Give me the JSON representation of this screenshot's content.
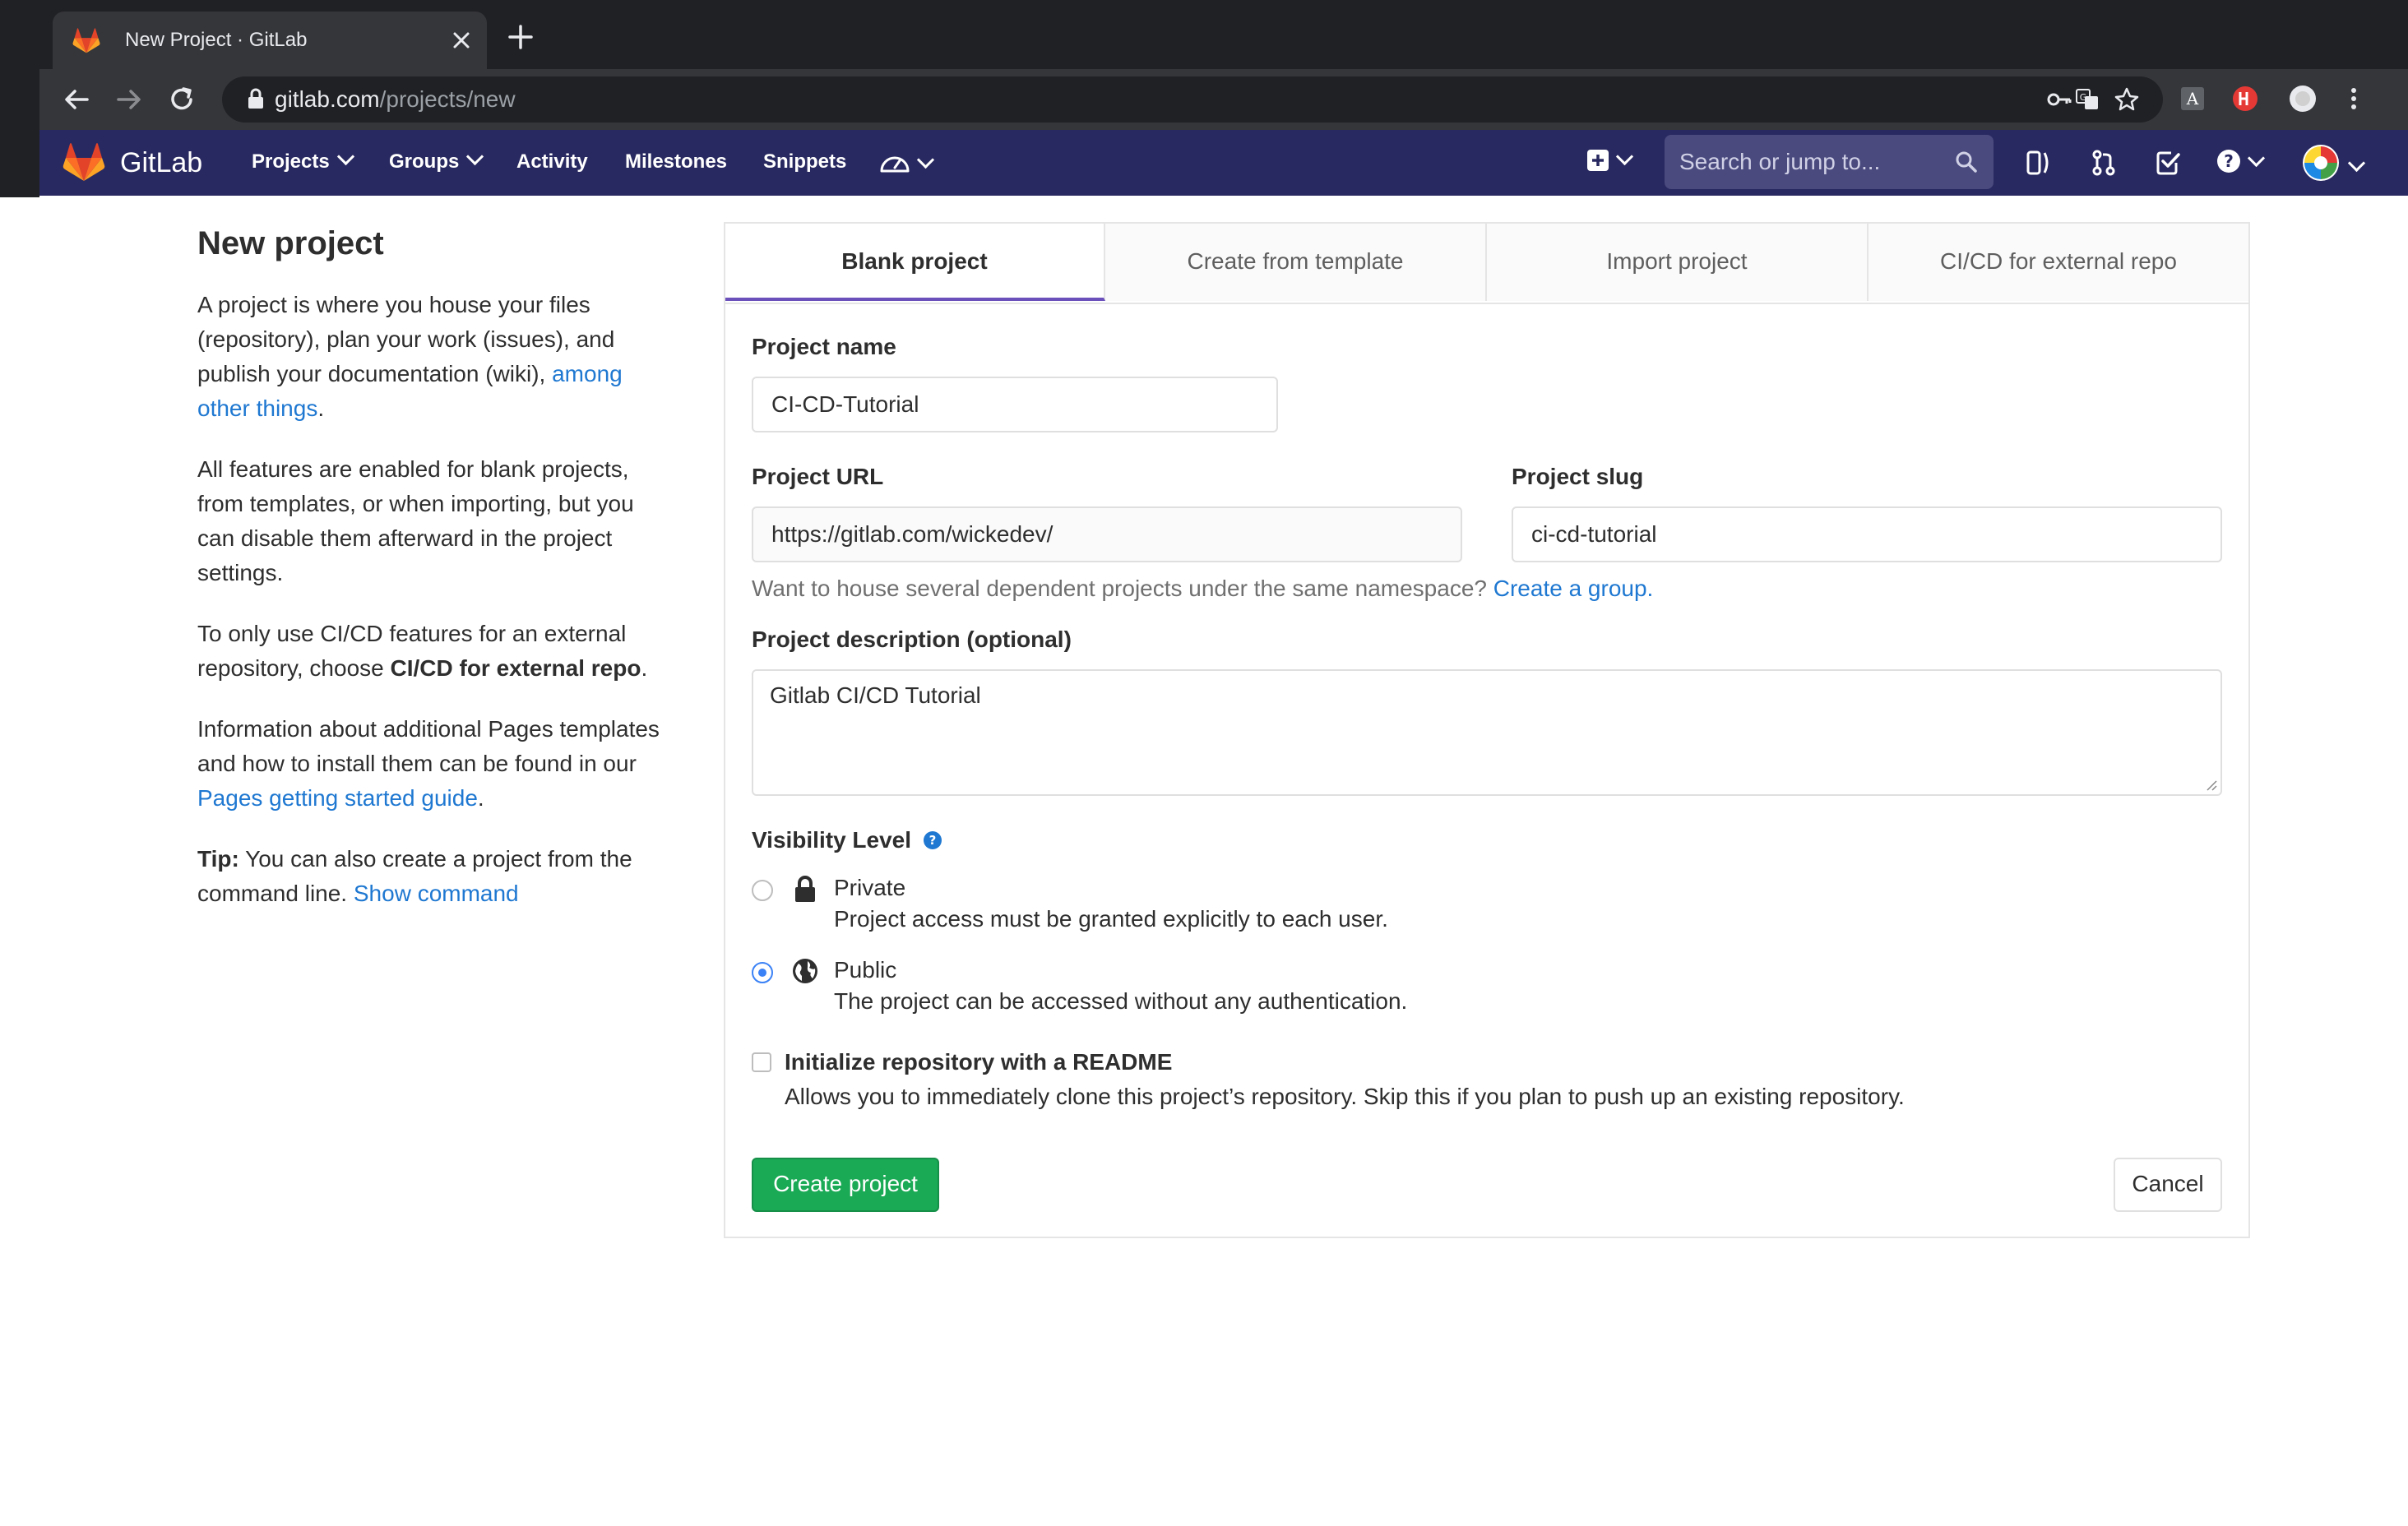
{
  "browser": {
    "tab_title": "New Project · GitLab",
    "url_host": "gitlab.com",
    "url_path": "/projects/new"
  },
  "navbar": {
    "brand": "GitLab",
    "links": [
      "Projects",
      "Groups",
      "Activity",
      "Milestones",
      "Snippets"
    ],
    "search_placeholder": "Search or jump to..."
  },
  "sidebar": {
    "title": "New project",
    "p1_text": "A project is where you house your files (repository), plan your work (issues), and publish your documentation (wiki), ",
    "p1_link": "among other things",
    "p1_end": ".",
    "p2": "All features are enabled for blank projects, from templates, or when importing, but you can disable them afterward in the project settings.",
    "p3_text": "To only use CI/CD features for an external repository, choose ",
    "p3_bold": "CI/CD for external repo",
    "p3_end": ".",
    "p4_text": "Information about additional Pages templates and how to install them can be found in our ",
    "p4_link": "Pages getting started guide",
    "p4_end": ".",
    "tip_label": "Tip:",
    "tip_text": " You can also create a project from the command line. ",
    "tip_link": "Show command"
  },
  "tabs": [
    "Blank project",
    "Create from template",
    "Import project",
    "CI/CD for external repo"
  ],
  "form": {
    "project_name_label": "Project name",
    "project_name_value": "CI-CD-Tutorial",
    "project_url_label": "Project URL",
    "project_url_value": "https://gitlab.com/wickedev/",
    "project_slug_label": "Project slug",
    "project_slug_value": "ci-cd-tutorial",
    "namespace_help": "Want to house several dependent projects under the same namespace? ",
    "namespace_link": "Create a group.",
    "description_label": "Project description (optional)",
    "description_value": "Gitlab CI/CD Tutorial",
    "visibility_label": "Visibility Level",
    "private_title": "Private",
    "private_desc": "Project access must be granted explicitly to each user.",
    "public_title": "Public",
    "public_desc": "The project can be accessed without any authentication.",
    "selected_visibility": "Public",
    "readme_label": "Initialize repository with a README",
    "readme_desc": "Allows you to immediately clone this project’s repository. Skip this if you plan to push up an existing repository.",
    "create_button": "Create project",
    "cancel_button": "Cancel"
  },
  "colors": {
    "navbar": "#292961",
    "link": "#1f78d1",
    "create_button": "#1aaa55",
    "active_tab": "#6b4fbb"
  }
}
